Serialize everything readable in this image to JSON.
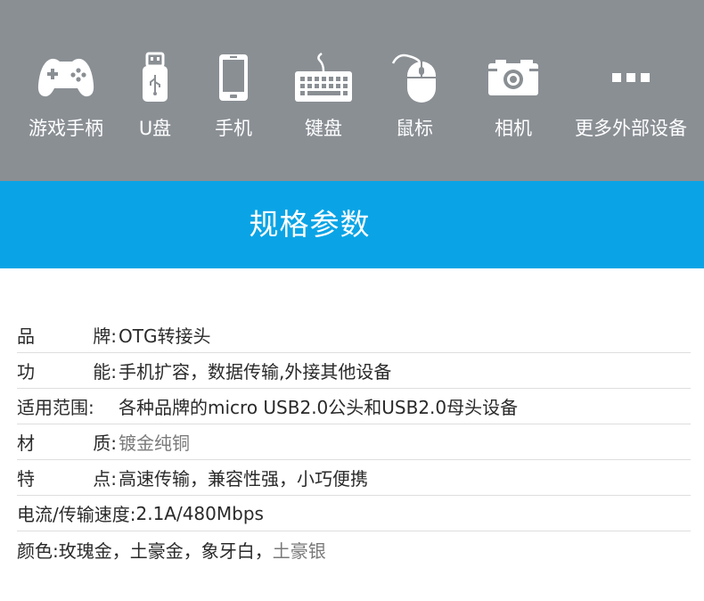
{
  "devices": [
    {
      "icon": "gamepad-icon",
      "label": "游戏手柄"
    },
    {
      "icon": "usb-drive-icon",
      "label": "U盘"
    },
    {
      "icon": "phone-icon",
      "label": "手机"
    },
    {
      "icon": "keyboard-icon",
      "label": "键盘"
    },
    {
      "icon": "mouse-icon",
      "label": "鼠标"
    },
    {
      "icon": "camera-icon",
      "label": "相机"
    },
    {
      "icon": "more-icon",
      "label": "更多外部设备"
    }
  ],
  "title": "规格参数",
  "specs": {
    "brand": {
      "k1": "品",
      "k2": "牌:",
      "value": "OTG转接头"
    },
    "function": {
      "k1": "功",
      "k2": "能:",
      "value": "手机扩容，数据传输,外接其他设备"
    },
    "scope": {
      "key": "适用范围:",
      "value": "各种品牌的micro USB2.0公头和USB2.0母头设备"
    },
    "material": {
      "k1": "材",
      "k2": "质:",
      "value": "镀金纯铜"
    },
    "feature": {
      "k1": "特",
      "k2": "点:",
      "value": "高速传输，兼容性强，小巧便携"
    },
    "speed": {
      "key": "电流/传输速度:",
      "value": "2.1A/480Mbps"
    },
    "color": {
      "key": "颜色:",
      "value": "玫瑰金，土豪金，象牙白，",
      "value_extra": "土豪银"
    }
  },
  "colors": {
    "top_band": "#8a8f94",
    "title_band": "#0aa4e6",
    "icon": "#ffffff"
  }
}
